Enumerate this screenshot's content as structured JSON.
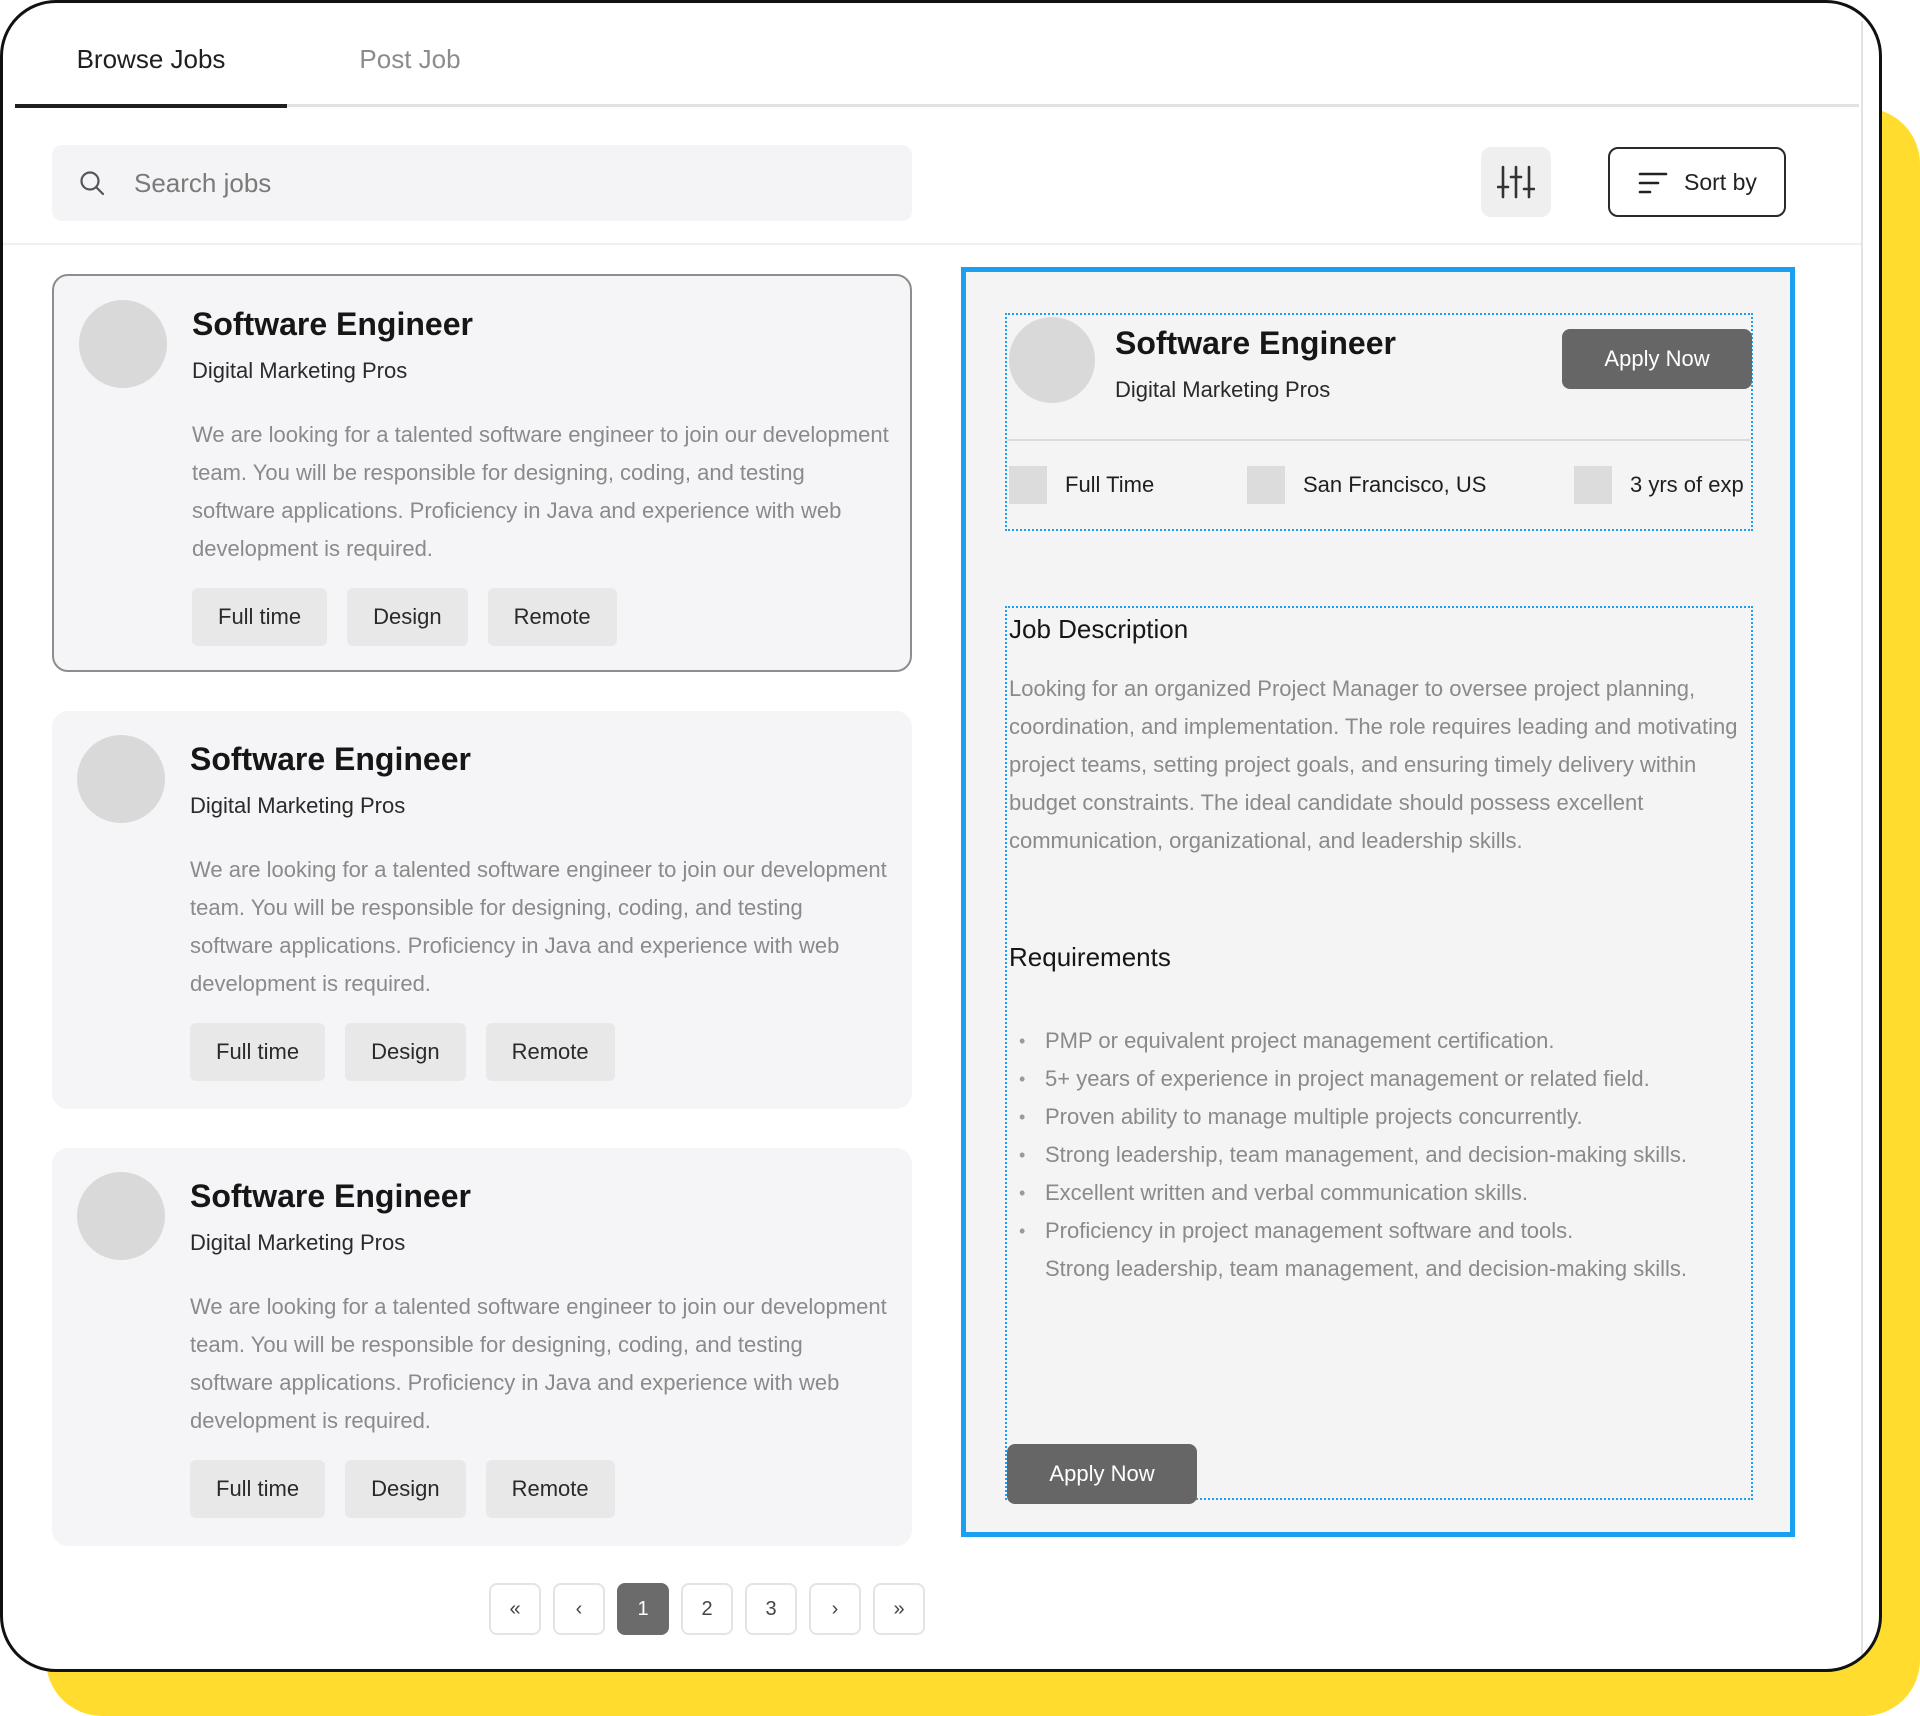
{
  "tabs": {
    "browse": "Browse Jobs",
    "post": "Post Job"
  },
  "search": {
    "placeholder": "Search jobs"
  },
  "toolbar": {
    "sort_label": "Sort by"
  },
  "jobs": [
    {
      "title": "Software Engineer",
      "company": "Digital Marketing Pros",
      "description": "We are looking for a talented software engineer to join our development team. You will be responsible for designing, coding, and testing software applications. Proficiency in Java and experience with web development is required.",
      "tags": [
        "Full time",
        "Design",
        "Remote"
      ]
    },
    {
      "title": "Software Engineer",
      "company": "Digital Marketing Pros",
      "description": "We are looking for a talented software engineer to join our development team. You will be responsible for designing, coding, and testing software applications. Proficiency in Java and experience with web development is required.",
      "tags": [
        "Full time",
        "Design",
        "Remote"
      ]
    },
    {
      "title": "Software Engineer",
      "company": "Digital Marketing Pros",
      "description": "We are looking for a talented software engineer to join our development team. You will be responsible for designing, coding, and testing software applications. Proficiency in Java and experience with web development is required.",
      "tags": [
        "Full time",
        "Design",
        "Remote"
      ]
    }
  ],
  "pagination": {
    "first": "«",
    "prev": "‹",
    "pages": [
      "1",
      "2",
      "3"
    ],
    "next": "›",
    "last": "»",
    "current": "1"
  },
  "detail": {
    "title": "Software Engineer",
    "company": "Digital Marketing Pros",
    "apply_label": "Apply Now",
    "meta": [
      "Full Time",
      "San Francisco, US",
      "3 yrs of exp"
    ],
    "description_heading": "Job Description",
    "description": "Looking for an organized Project Manager to oversee project planning, coordination, and implementation. The role requires leading and motivating project teams, setting project goals, and ensuring timely delivery within budget constraints. The ideal candidate should possess excellent communication, organizational, and leadership skills.",
    "requirements_heading": "Requirements",
    "requirements": [
      "PMP or equivalent project management certification.",
      "5+ years of experience in project management or related field.",
      "Proven ability to manage multiple projects concurrently.",
      "Strong leadership, team management, and decision-making skills.",
      "Excellent written and verbal communication skills.",
      "Proficiency in project management software and tools.",
      "Strong leadership, team management, and decision-making skills."
    ]
  },
  "colors": {
    "accent_blue": "#1aa0f0",
    "frame_yellow": "#FFDC2E",
    "button_gray": "#666666"
  }
}
